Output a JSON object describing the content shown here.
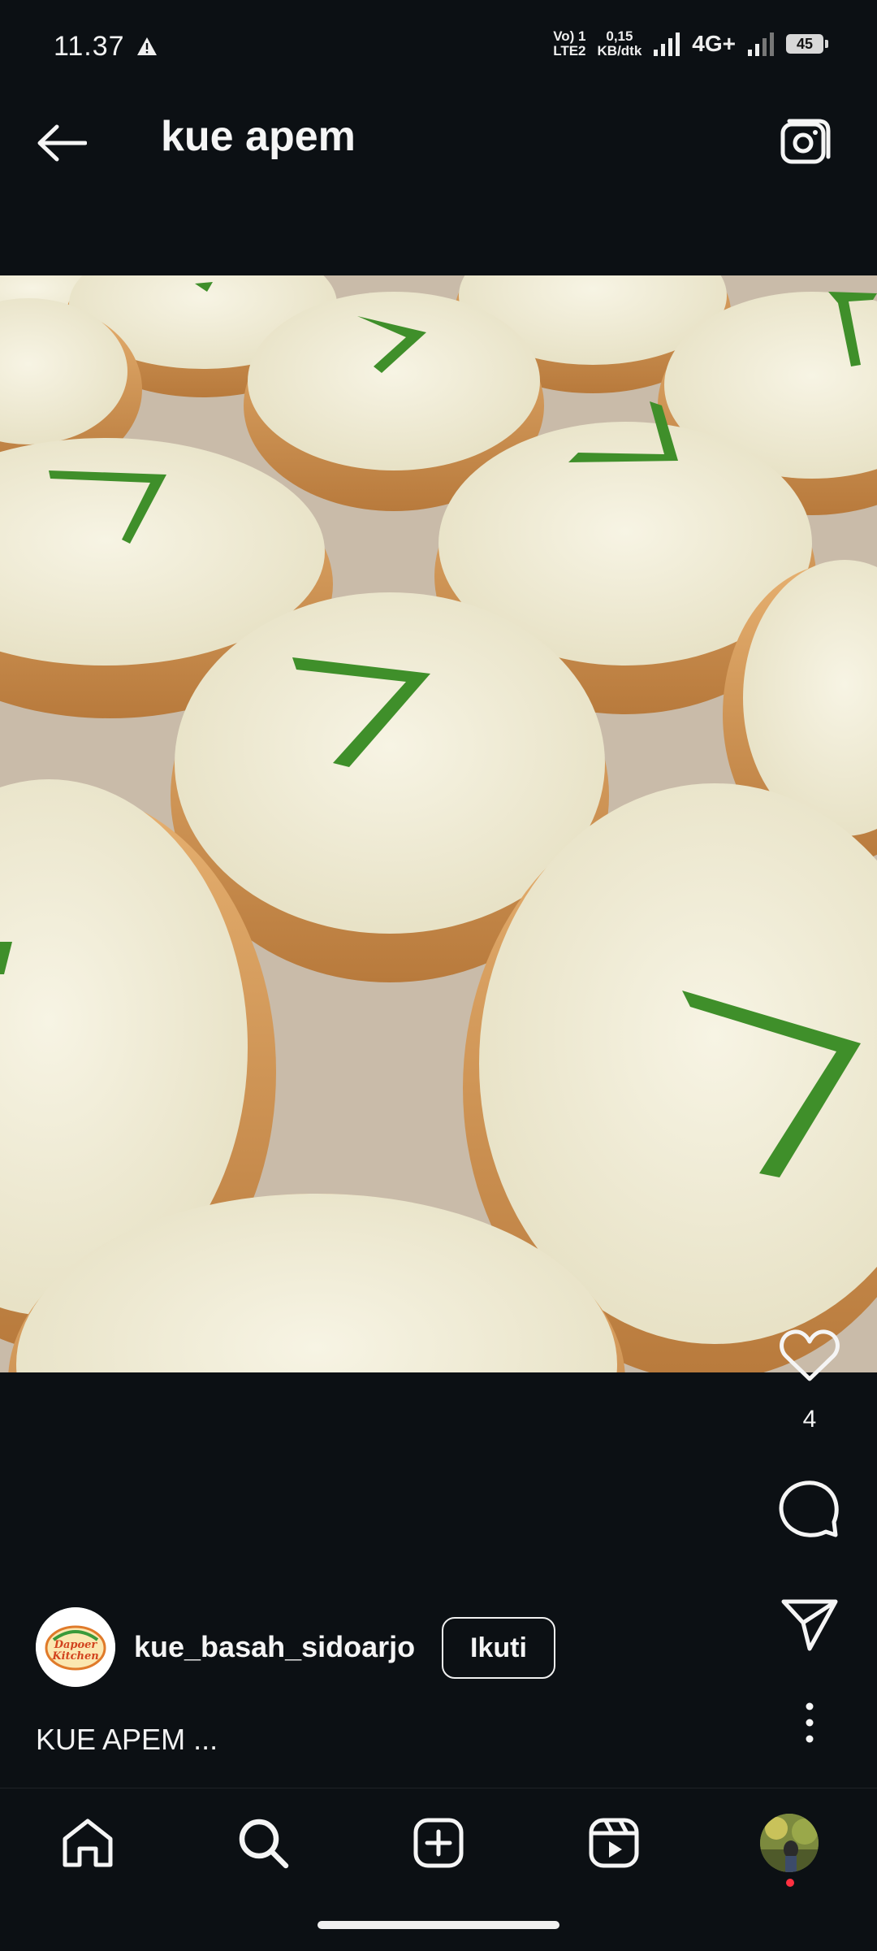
{
  "status_bar": {
    "time": "11.37",
    "volte_top": "Vo) 1",
    "volte_bottom": "LTE2",
    "speed_top": "0,15",
    "speed_bottom": "KB/dtk",
    "network": "4G+",
    "battery": "45"
  },
  "header": {
    "title": "kue apem",
    "back_icon": "arrow-left-icon",
    "camera_icon": "camera-icon"
  },
  "post": {
    "image_alt": "kue apem",
    "likes": "4",
    "username": "kue_basah_sidoarjo",
    "follow_label": "Ikuti",
    "caption": "KUE APEM ...",
    "avatar_text": "Dapoer Kitchen"
  },
  "nav": {
    "items": [
      "home-icon",
      "search-icon",
      "create-icon",
      "reels-icon",
      "profile-avatar"
    ]
  },
  "colors": {
    "background": "#0c1014",
    "text": "#f5f5f5",
    "notification_dot": "#ff3040"
  }
}
